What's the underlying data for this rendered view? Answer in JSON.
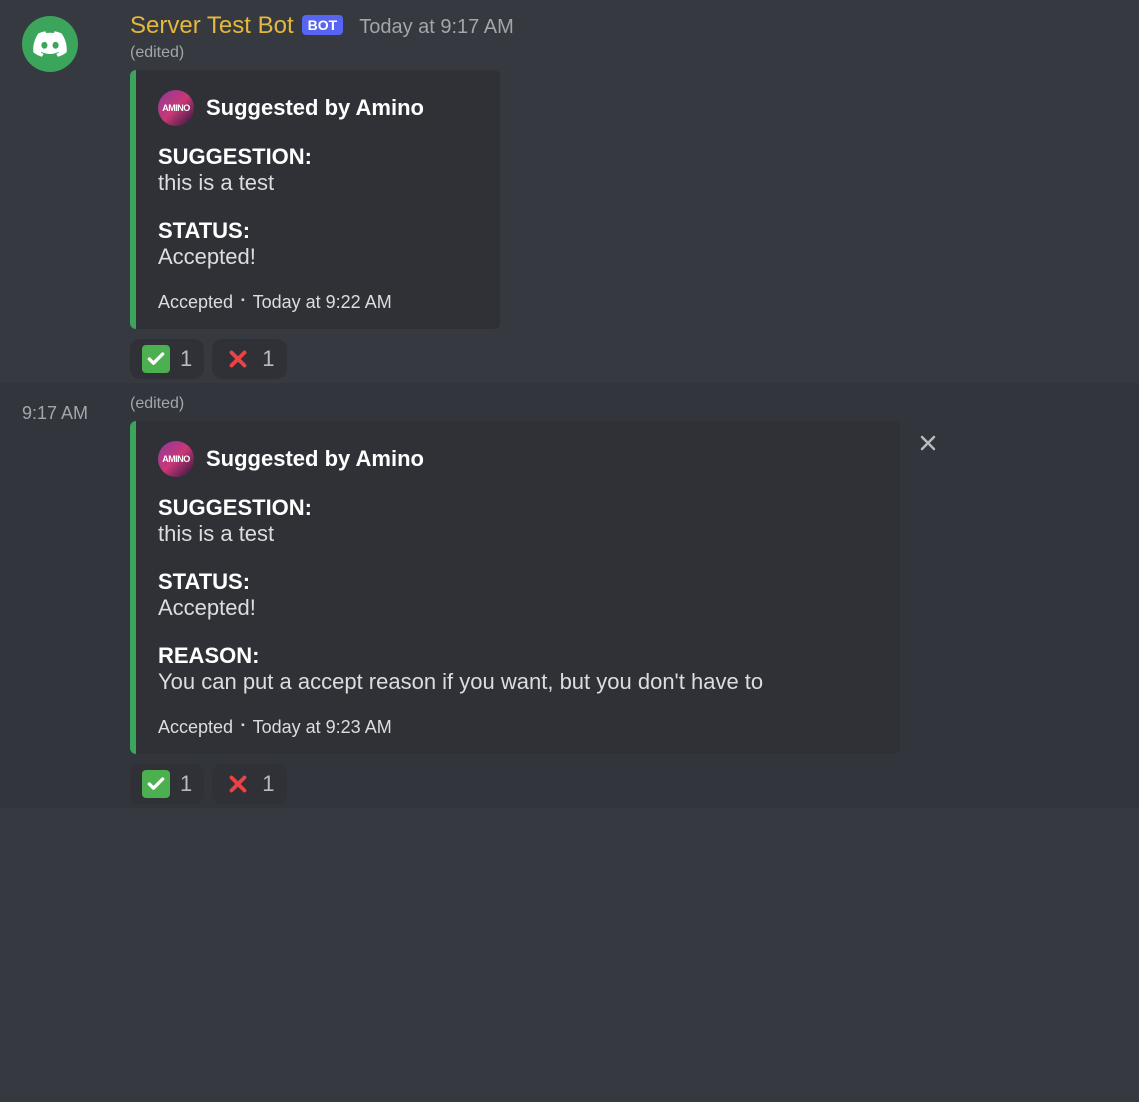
{
  "message1": {
    "username": "Server Test Bot",
    "bot_badge": "BOT",
    "timestamp": "Today at 9:17 AM",
    "edited": "(edited)",
    "embed": {
      "author_avatar_text": "AMINO",
      "author_name": "Suggested by Amino",
      "suggestion_label": "SUGGESTION:",
      "suggestion_value": "this is a test",
      "status_label": "STATUS:",
      "status_value": "Accepted!",
      "footer_status": "Accepted",
      "footer_time": "Today at 9:22 AM"
    },
    "reactions": {
      "check_count": "1",
      "cross_count": "1"
    }
  },
  "message2": {
    "side_time": "9:17 AM",
    "edited": "(edited)",
    "embed": {
      "author_avatar_text": "AMINO",
      "author_name": "Suggested by Amino",
      "suggestion_label": "SUGGESTION:",
      "suggestion_value": "this is a test",
      "status_label": "STATUS:",
      "status_value": "Accepted!",
      "reason_label": "REASON:",
      "reason_value": "You can put a accept reason if you want, but you don't have to",
      "footer_status": "Accepted",
      "footer_time": "Today at 9:23 AM"
    },
    "reactions": {
      "check_count": "1",
      "cross_count": "1"
    }
  }
}
